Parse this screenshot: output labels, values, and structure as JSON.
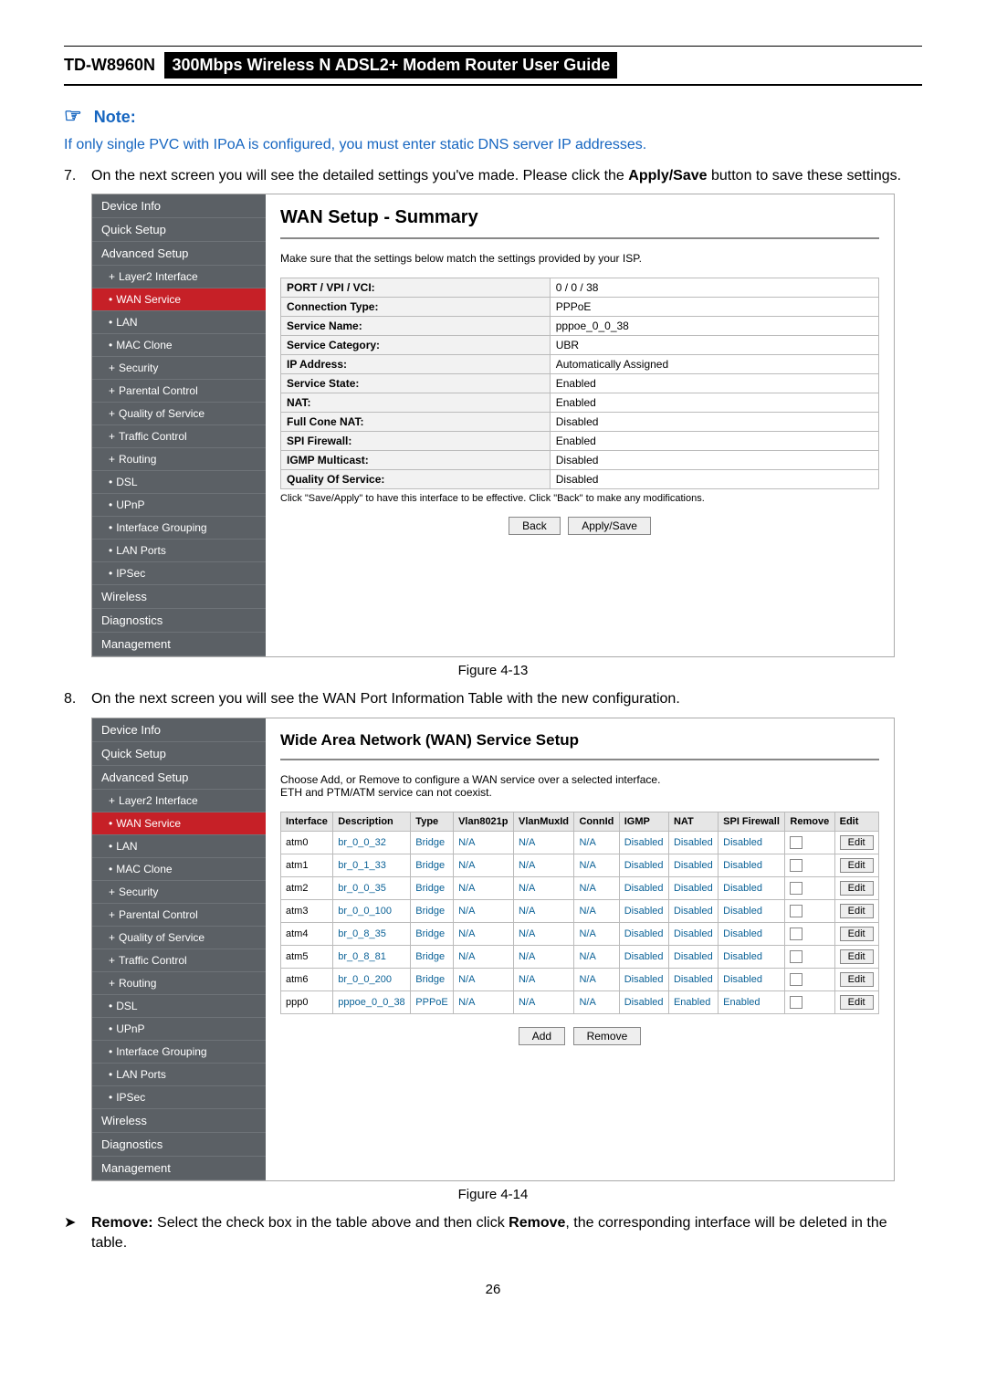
{
  "header": {
    "model": "TD-W8960N",
    "title": "300Mbps Wireless N ADSL2+ Modem Router User Guide"
  },
  "note_label": "Note:",
  "note_text": "If only single PVC with IPoA is configured, you must enter static DNS server IP addresses.",
  "step7": {
    "num": "7.",
    "text_a": "On the next screen you will see the detailed settings you've made. Please click the ",
    "bold": "Apply/Save",
    "text_b": " button to save these settings."
  },
  "nav1": [
    {
      "label": "Device Info",
      "cls": ""
    },
    {
      "label": "Quick Setup",
      "cls": ""
    },
    {
      "label": "Advanced Setup",
      "cls": ""
    },
    {
      "label": "Layer2 Interface",
      "cls": "sub plus"
    },
    {
      "label": "WAN Service",
      "cls": "sub bullet active"
    },
    {
      "label": "LAN",
      "cls": "sub bullet"
    },
    {
      "label": "MAC Clone",
      "cls": "sub bullet"
    },
    {
      "label": "Security",
      "cls": "sub plus"
    },
    {
      "label": "Parental Control",
      "cls": "sub plus"
    },
    {
      "label": "Quality of Service",
      "cls": "sub plus"
    },
    {
      "label": "Traffic Control",
      "cls": "sub plus"
    },
    {
      "label": "Routing",
      "cls": "sub plus"
    },
    {
      "label": "DSL",
      "cls": "sub bullet"
    },
    {
      "label": "UPnP",
      "cls": "sub bullet"
    },
    {
      "label": "Interface Grouping",
      "cls": "sub bullet"
    },
    {
      "label": "LAN Ports",
      "cls": "sub bullet"
    },
    {
      "label": "IPSec",
      "cls": "sub bullet"
    },
    {
      "label": "Wireless",
      "cls": ""
    },
    {
      "label": "Diagnostics",
      "cls": ""
    },
    {
      "label": "Management",
      "cls": ""
    }
  ],
  "summary": {
    "title": "WAN Setup - Summary",
    "help": "Make sure that the settings below match the settings provided by your ISP.",
    "rows": [
      {
        "k": "PORT / VPI / VCI:",
        "v": "0 / 0 / 38"
      },
      {
        "k": "Connection Type:",
        "v": "PPPoE"
      },
      {
        "k": "Service Name:",
        "v": "pppoe_0_0_38"
      },
      {
        "k": "Service Category:",
        "v": "UBR"
      },
      {
        "k": "IP Address:",
        "v": "Automatically Assigned"
      },
      {
        "k": "Service State:",
        "v": "Enabled"
      },
      {
        "k": "NAT:",
        "v": "Enabled"
      },
      {
        "k": "Full Cone NAT:",
        "v": "Disabled"
      },
      {
        "k": "SPI Firewall:",
        "v": "Enabled"
      },
      {
        "k": "IGMP Multicast:",
        "v": "Disabled"
      },
      {
        "k": "Quality Of Service:",
        "v": "Disabled"
      }
    ],
    "footnote": "Click \"Save/Apply\" to have this interface to be effective. Click \"Back\" to make any modifications.",
    "btn_back": "Back",
    "btn_apply": "Apply/Save"
  },
  "fig1": "Figure 4-13",
  "step8": {
    "num": "8.",
    "text": "On the next screen you will see the WAN Port Information Table with the new configuration."
  },
  "nav2": [
    {
      "label": "Device Info",
      "cls": ""
    },
    {
      "label": "Quick Setup",
      "cls": ""
    },
    {
      "label": "Advanced Setup",
      "cls": ""
    },
    {
      "label": "Layer2 Interface",
      "cls": "sub plus"
    },
    {
      "label": "WAN Service",
      "cls": "sub bullet active"
    },
    {
      "label": "LAN",
      "cls": "sub bullet"
    },
    {
      "label": "MAC Clone",
      "cls": "sub bullet"
    },
    {
      "label": "Security",
      "cls": "sub plus"
    },
    {
      "label": "Parental Control",
      "cls": "sub plus"
    },
    {
      "label": "Quality of Service",
      "cls": "sub plus"
    },
    {
      "label": "Traffic Control",
      "cls": "sub plus"
    },
    {
      "label": "Routing",
      "cls": "sub plus"
    },
    {
      "label": "DSL",
      "cls": "sub bullet"
    },
    {
      "label": "UPnP",
      "cls": "sub bullet"
    },
    {
      "label": "Interface Grouping",
      "cls": "sub bullet"
    },
    {
      "label": "LAN Ports",
      "cls": "sub bullet"
    },
    {
      "label": "IPSec",
      "cls": "sub bullet"
    },
    {
      "label": "Wireless",
      "cls": ""
    },
    {
      "label": "Diagnostics",
      "cls": ""
    },
    {
      "label": "Management",
      "cls": ""
    }
  ],
  "wan": {
    "title": "Wide Area Network (WAN) Service Setup",
    "help1": "Choose Add, or Remove to configure a WAN service over a selected interface.",
    "help2": "ETH and PTM/ATM service can not coexist.",
    "headers": [
      "Interface",
      "Description",
      "Type",
      "Vlan8021p",
      "VlanMuxId",
      "ConnId",
      "IGMP",
      "NAT",
      "SPI Firewall",
      "Remove",
      "Edit"
    ],
    "rows": [
      {
        "c": [
          "atm0",
          "br_0_0_32",
          "Bridge",
          "N/A",
          "N/A",
          "N/A",
          "Disabled",
          "Disabled",
          "Disabled"
        ]
      },
      {
        "c": [
          "atm1",
          "br_0_1_33",
          "Bridge",
          "N/A",
          "N/A",
          "N/A",
          "Disabled",
          "Disabled",
          "Disabled"
        ]
      },
      {
        "c": [
          "atm2",
          "br_0_0_35",
          "Bridge",
          "N/A",
          "N/A",
          "N/A",
          "Disabled",
          "Disabled",
          "Disabled"
        ]
      },
      {
        "c": [
          "atm3",
          "br_0_0_100",
          "Bridge",
          "N/A",
          "N/A",
          "N/A",
          "Disabled",
          "Disabled",
          "Disabled"
        ]
      },
      {
        "c": [
          "atm4",
          "br_0_8_35",
          "Bridge",
          "N/A",
          "N/A",
          "N/A",
          "Disabled",
          "Disabled",
          "Disabled"
        ]
      },
      {
        "c": [
          "atm5",
          "br_0_8_81",
          "Bridge",
          "N/A",
          "N/A",
          "N/A",
          "Disabled",
          "Disabled",
          "Disabled"
        ]
      },
      {
        "c": [
          "atm6",
          "br_0_0_200",
          "Bridge",
          "N/A",
          "N/A",
          "N/A",
          "Disabled",
          "Disabled",
          "Disabled"
        ]
      },
      {
        "c": [
          "ppp0",
          "pppoe_0_0_38",
          "PPPoE",
          "N/A",
          "N/A",
          "N/A",
          "Disabled",
          "Enabled",
          "Enabled"
        ]
      }
    ],
    "btn_add": "Add",
    "btn_remove": "Remove",
    "edit_label": "Edit"
  },
  "fig2": "Figure 4-14",
  "remove_item": {
    "tri": "➤",
    "bold": "Remove:",
    "text_a": " Select the check box in the table above and then click ",
    "bold2": "Remove",
    "text_b": ", the corresponding interface will be deleted in the table."
  },
  "page_num": "26"
}
